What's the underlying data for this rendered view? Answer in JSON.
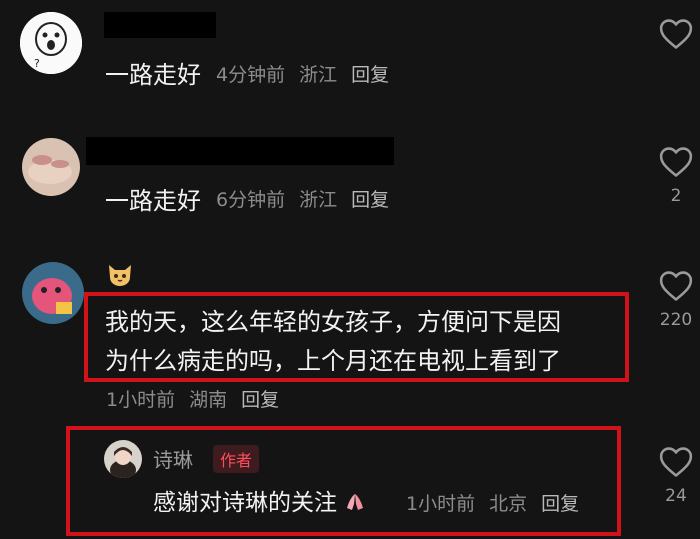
{
  "comments": [
    {
      "text": "一路走好",
      "time": "4分钟前",
      "location": "浙江",
      "reply_label": "回复",
      "like_count": ""
    },
    {
      "text": "一路走好",
      "time": "6分钟前",
      "location": "浙江",
      "reply_label": "回复",
      "like_count": "2"
    },
    {
      "text_line1": "我的天，这么年轻的女孩子，方便问下是因",
      "text_line2": "为什么病走的吗，上个月还在电视上看到了",
      "time": "1小时前",
      "location": "湖南",
      "reply_label": "回复",
      "like_count": "220",
      "badge_icon": "cat-emoji-icon"
    }
  ],
  "author_reply": {
    "name": "诗琳",
    "badge": "作者",
    "text": "感谢对诗琳的关注",
    "emoji_icon": "pray-hands-emoji-icon",
    "time": "1小时前",
    "location": "北京",
    "reply_label": "回复",
    "like_count": "24"
  },
  "colors": {
    "background": "#141414",
    "highlight_border": "#d0121a",
    "author_badge": "#ff4d5e"
  }
}
